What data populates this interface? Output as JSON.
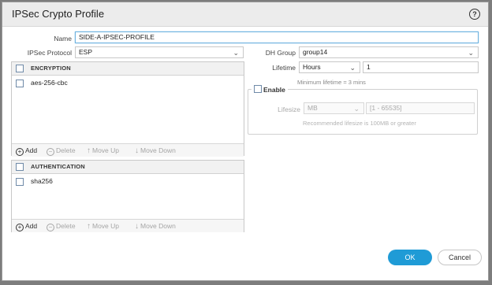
{
  "dialog": {
    "title": "IPSec Crypto Profile",
    "help_icon": "?"
  },
  "form": {
    "name_label": "Name",
    "name_value": "SIDE-A-IPSEC-PROFILE",
    "protocol_label": "IPSec Protocol",
    "protocol_value": "ESP",
    "dh_group_label": "DH Group",
    "dh_group_value": "group14",
    "lifetime_label": "Lifetime",
    "lifetime_unit": "Hours",
    "lifetime_value": "1",
    "lifetime_note": "Minimum lifetime = 3 mins"
  },
  "encryption": {
    "header": "ENCRYPTION",
    "rows": [
      "aes-256-cbc"
    ]
  },
  "authentication": {
    "header": "AUTHENTICATION",
    "rows": [
      "sha256"
    ]
  },
  "toolbar": {
    "add": "Add",
    "delete": "Delete",
    "move_up": "Move Up",
    "move_down": "Move Down"
  },
  "lifesize": {
    "enable_label": "Enable",
    "lifesize_label": "Lifesize",
    "unit_value": "MB",
    "range_placeholder": "[1 - 65535]",
    "note": "Recommended lifesize is 100MB or greater"
  },
  "buttons": {
    "ok": "OK",
    "cancel": "Cancel"
  },
  "colors": {
    "primary": "#1f9bd6",
    "titlebar": "#ececec",
    "focus_border": "#6fb3e0"
  }
}
